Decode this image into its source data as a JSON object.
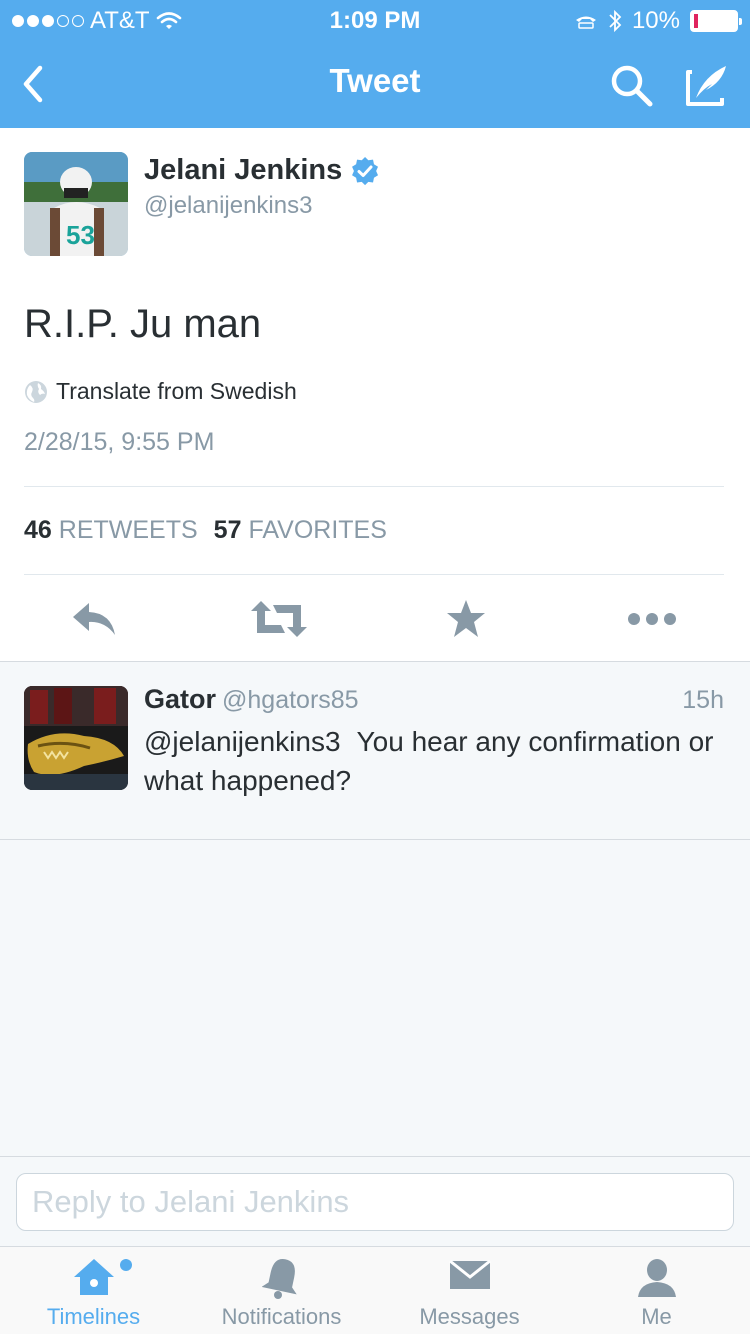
{
  "status_bar": {
    "carrier": "AT&T",
    "time": "1:09 PM",
    "battery": "10%",
    "signal_bars_filled": 3,
    "signal_bars_total": 5,
    "battery_level": 0.1
  },
  "navbar": {
    "title": "Tweet",
    "icons": [
      "back-chevron-icon",
      "search-icon",
      "compose-icon"
    ]
  },
  "tweet": {
    "author_name": "Jelani Jenkins",
    "author_handle": "@jelanijenkins3",
    "verified": true,
    "text": "R.I.P. Ju man",
    "translate_label": "Translate from Swedish",
    "timestamp": "2/28/15, 9:55 PM",
    "retweets_count": "46",
    "retweets_label": "RETWEETS",
    "favorites_count": "57",
    "favorites_label": "FAVORITES",
    "actions": [
      "reply-icon",
      "retweet-icon",
      "favorite-star-icon",
      "more-icon"
    ]
  },
  "reply": {
    "author_name": "Gator",
    "author_handle": "@hgators85",
    "time": "15h",
    "mention": "@jelanijenkins3",
    "text": "You hear any confirmation or what happened?"
  },
  "reply_bar": {
    "placeholder": "Reply to Jelani Jenkins"
  },
  "tabbar": {
    "tabs": [
      {
        "label": "Timelines",
        "icon": "home-icon",
        "active": true,
        "has_new": true
      },
      {
        "label": "Notifications",
        "icon": "bell-icon",
        "active": false
      },
      {
        "label": "Messages",
        "icon": "envelope-icon",
        "active": false
      },
      {
        "label": "Me",
        "icon": "person-icon",
        "active": false
      }
    ]
  },
  "colors": {
    "brand": "#55acee",
    "action_gray": "#8899a6",
    "text": "#292f33"
  }
}
